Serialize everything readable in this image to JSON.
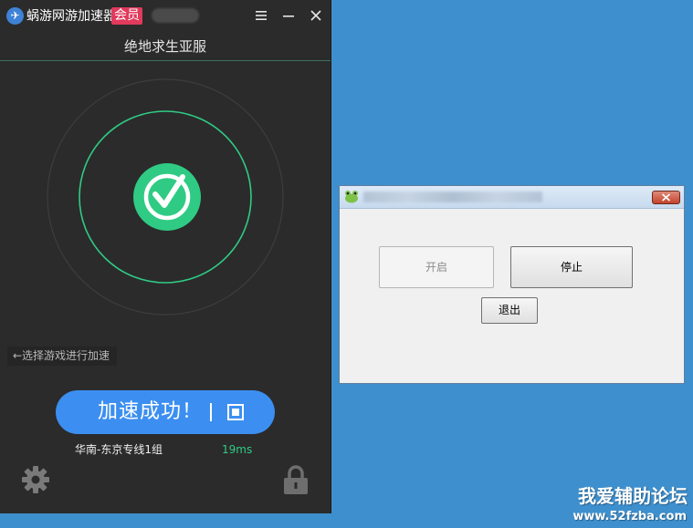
{
  "accelerator": {
    "app_name": "蜗游网游加速器",
    "vip_badge": "会员",
    "game_name": "绝地求生亚服",
    "select_hint": "←选择游戏进行加速",
    "status_button": "加速成功！",
    "route": "华南-东京专线1组",
    "ping": "19ms",
    "icons": {
      "logo": "rocket-logo-icon",
      "menu": "menu-icon",
      "minimize": "minimize-icon",
      "close": "close-icon",
      "success": "check-circle-icon",
      "stop": "stop-square-icon",
      "settings": "gear-icon",
      "lock": "lock-icon"
    },
    "colors": {
      "accent_green": "#2fcb84",
      "button_blue": "#3c8ff0",
      "vip_pink": "#e03a5c",
      "background": "#2b2b2b"
    }
  },
  "dialog": {
    "start_label": "开启",
    "stop_label": "停止",
    "exit_label": "退出"
  },
  "watermark": {
    "text": "我爱辅助论坛",
    "url": "www.52fzba.com"
  }
}
